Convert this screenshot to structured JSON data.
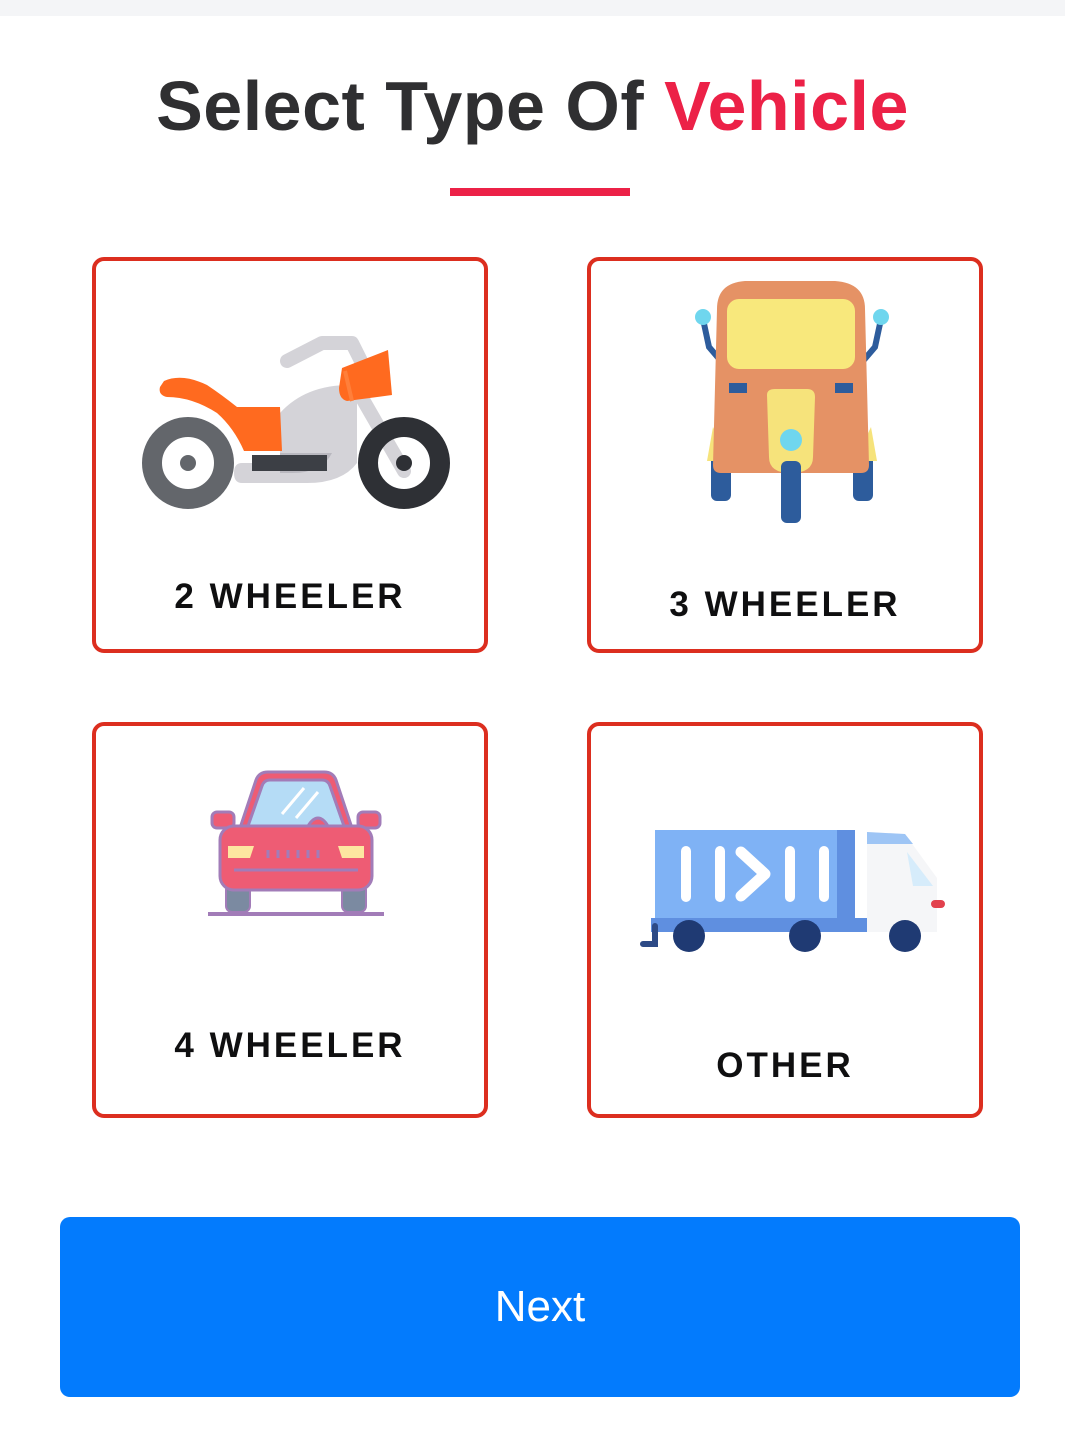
{
  "header": {
    "title_main": "Select Type Of ",
    "title_accent": "Vehicle"
  },
  "vehicle_options": [
    {
      "label": "2 WHEELER",
      "icon": "motorcycle-icon"
    },
    {
      "label": "3 WHEELER",
      "icon": "auto-rickshaw-icon"
    },
    {
      "label": "4 WHEELER",
      "icon": "car-icon"
    },
    {
      "label": "OTHER",
      "icon": "truck-icon"
    }
  ],
  "actions": {
    "next_label": "Next"
  },
  "colors": {
    "accent": "#ec2147",
    "card_border": "#dc2e1f",
    "button": "#037bfd",
    "title_text": "#2f2f31"
  }
}
